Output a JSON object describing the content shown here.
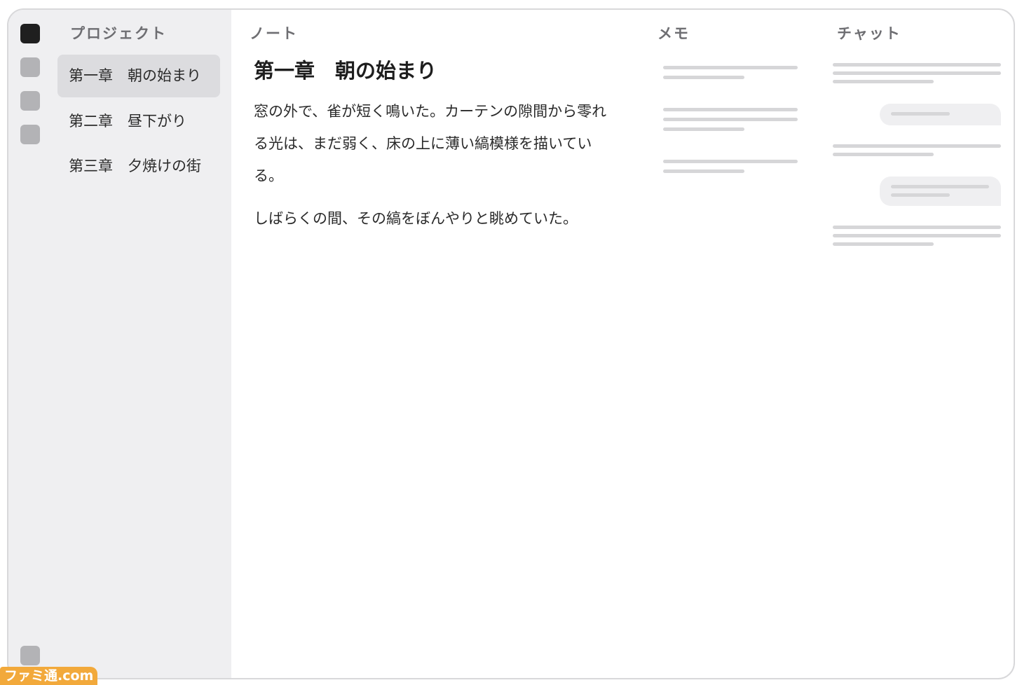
{
  "sidebar": {
    "header": "プロジェクト",
    "chapters": [
      {
        "label": "第一章　朝の始まり"
      },
      {
        "label": "第二章　昼下がり"
      },
      {
        "label": "第三章　夕焼けの街"
      }
    ],
    "selected_index": 0
  },
  "note": {
    "header": "ノート",
    "title": "第一章　朝の始まり",
    "paragraphs": [
      "窓の外で、雀が短く鳴いた。カーテンの隙間から零れる光は、まだ弱く、床の上に薄い縞模様を描いている。",
      "しばらくの間、その縞をぼんやりと眺めていた。"
    ]
  },
  "memo": {
    "header": "メモ"
  },
  "chat": {
    "header": "チャット"
  },
  "watermark": "ファミ通.com",
  "colors": {
    "rail_active": "#1f1f1f",
    "rail_inactive": "#b3b3b6",
    "sidebar_bg": "#efeff1",
    "selected_bg": "#dcdcdf",
    "placeholder_bar": "#d6d6d8",
    "logo_orange": "#f2a93b"
  }
}
